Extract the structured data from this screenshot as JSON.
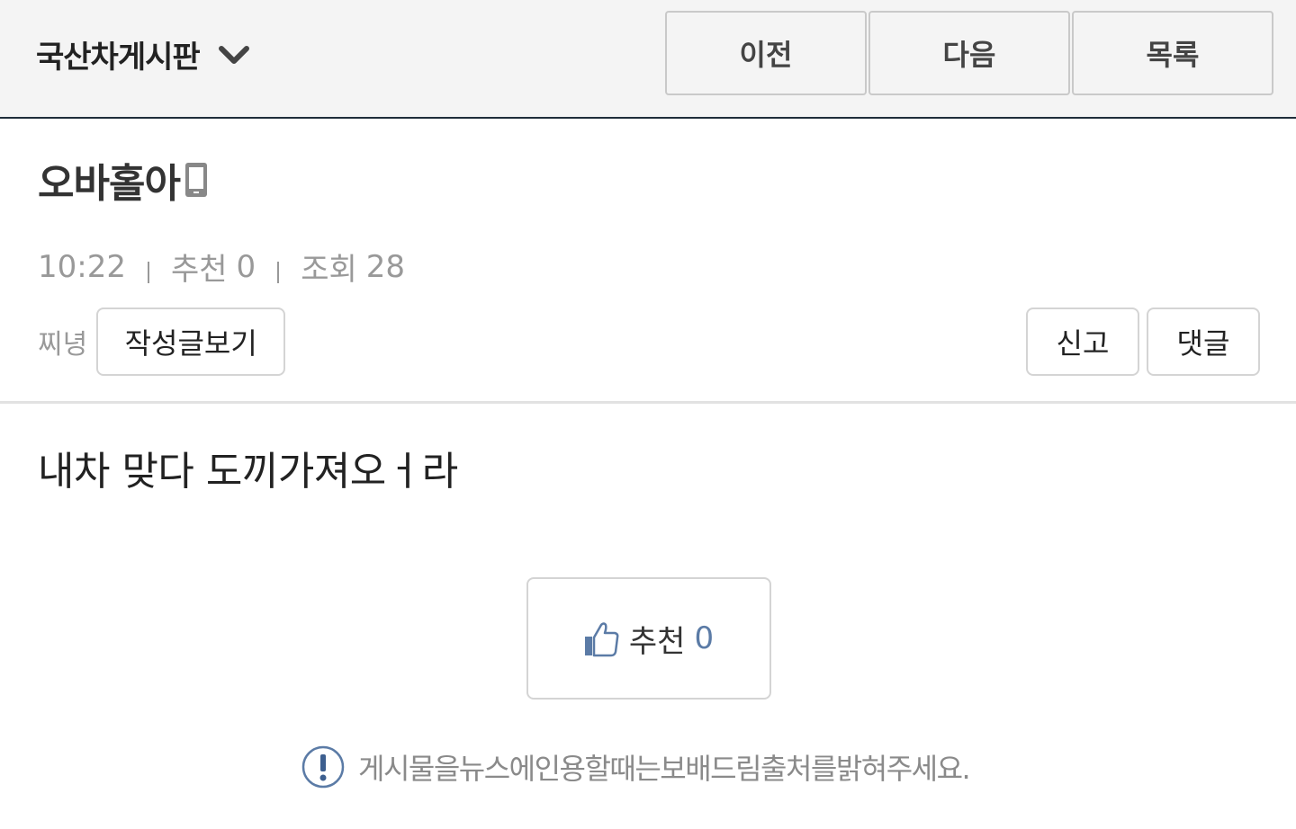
{
  "header": {
    "board_name": "국산차게시판",
    "nav": {
      "prev_label": "이전",
      "next_label": "다음",
      "list_label": "목록"
    }
  },
  "post": {
    "title": "오바홀아",
    "time": "10:22",
    "recommend_label": "추천",
    "recommend_count": "0",
    "views_label": "조회",
    "views_count": "28",
    "author": "찌녕",
    "view_posts_label": "작성글보기",
    "report_label": "신고",
    "comment_label": "댓글",
    "body": "내차 맞다 도끼가져오ㅓ라"
  },
  "recommend_box": {
    "label": "추천",
    "count": "0"
  },
  "notice": {
    "text": "게시물을뉴스에인용할때는보배드림출처를밝혀주세요."
  },
  "colors": {
    "header_bg": "#f4f4f4",
    "header_border": "#1f2d3a",
    "accent_blue": "#5b7ba6",
    "meta_gray": "#999999"
  }
}
